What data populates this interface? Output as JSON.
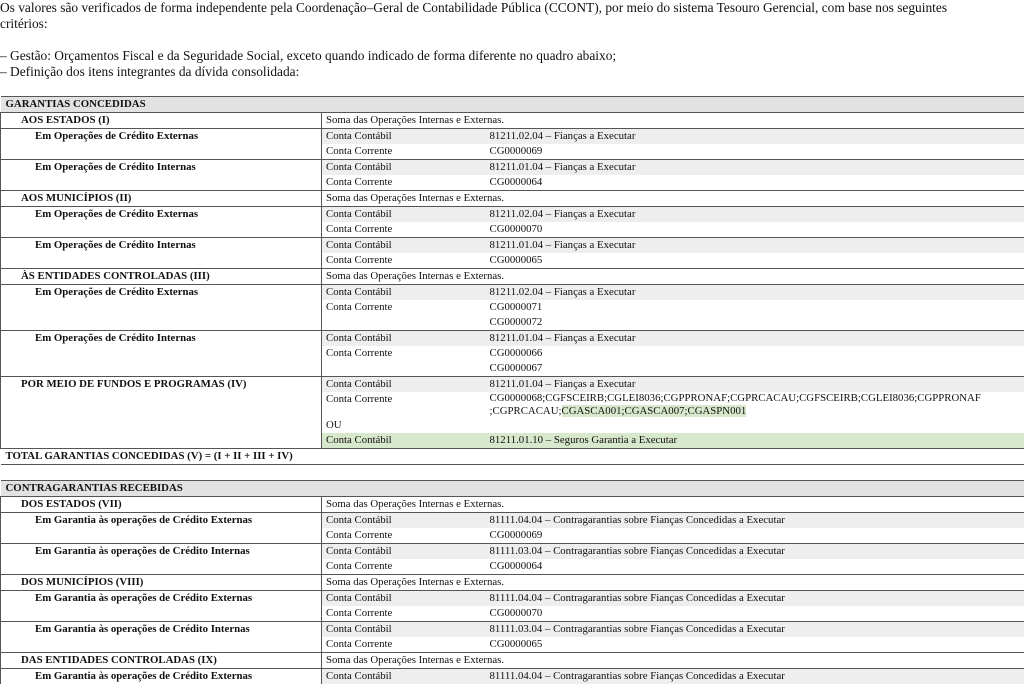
{
  "intro": {
    "line1": "Os valores são verificados de forma independente pela Coordenação–Geral de Contabilidade Pública (CCONT), por meio do sistema Tesouro Gerencial, com base nos seguintes",
    "line2": "critérios:",
    "line3": "– Gestão: Orçamentos Fiscal e da Seguridade Social, exceto quando indicado de forma diferente no quadro abaixo;",
    "line4": "– Definição dos itens integrantes da dívida consolidada:"
  },
  "labels": {
    "conta_contabil": "Conta Contábil",
    "conta_corrente": "Conta Corrente",
    "soma": "Soma das Operações Internas e Externas.",
    "ou": "OU"
  },
  "garantias": {
    "header": "GARANTIAS CONCEDIDAS",
    "estados": "AOS ESTADOS (I)",
    "municipios": "AOS MUNICÍPIOS (II)",
    "entidades": "ÀS ENTIDADES CONTROLADAS (III)",
    "fundos": "POR MEIO DE FUNDOS E PROGRAMAS (IV)",
    "total": "TOTAL GARANTIAS CONCEDIDAS (V) = (I + II + III + IV)",
    "op_externas": "Em Operações de Crédito Externas",
    "op_internas": "Em Operações de Crédito Internas",
    "acc_ext": "81211.02.04 – Fianças a Executar",
    "acc_int": "81211.01.04 – Fianças a Executar",
    "cg69": "CG0000069",
    "cg64": "CG0000064",
    "cg70": "CG0000070",
    "cg65": "CG0000065",
    "cg71": "CG0000071",
    "cg72": "CG0000072",
    "cg66": "CG0000066",
    "cg67": "CG0000067",
    "fundos_cc_line1": "CG0000068;CGFSCEIRB;CGLEI8036;CGPPRONAF;CGPRCACAU;CGFSCEIRB;CGLEI8036;CGPPRONAF",
    "fundos_cc_line2_plain": ";CGPRCACAU;",
    "fundos_cc_line2_hl": "CGASCA001;CGASCA007;CGASPN001",
    "acc_seguros": "81211.01.10 – Seguros Garantia a Executar"
  },
  "contragarantias": {
    "header": "CONTRAGARANTIAS RECEBIDAS",
    "estados": "DOS ESTADOS (VII)",
    "municipios": "DOS MUNICÍPIOS (VIII)",
    "entidades": "DAS ENTIDADES CONTROLADAS (IX)",
    "gar_externas": "Em Garantia às operações de Crédito Externas",
    "gar_internas": "Em Garantia às operações de Crédito Internas",
    "acc_ext": "81111.04.04 – Contragarantias sobre Fianças Concedidas a Executar",
    "acc_int": "81111.03.04 – Contragarantias sobre Fianças Concedidas a Executar",
    "cg69": "CG0000069",
    "cg64": "CG0000064",
    "cg70": "CG0000070",
    "cg65": "CG0000065"
  }
}
